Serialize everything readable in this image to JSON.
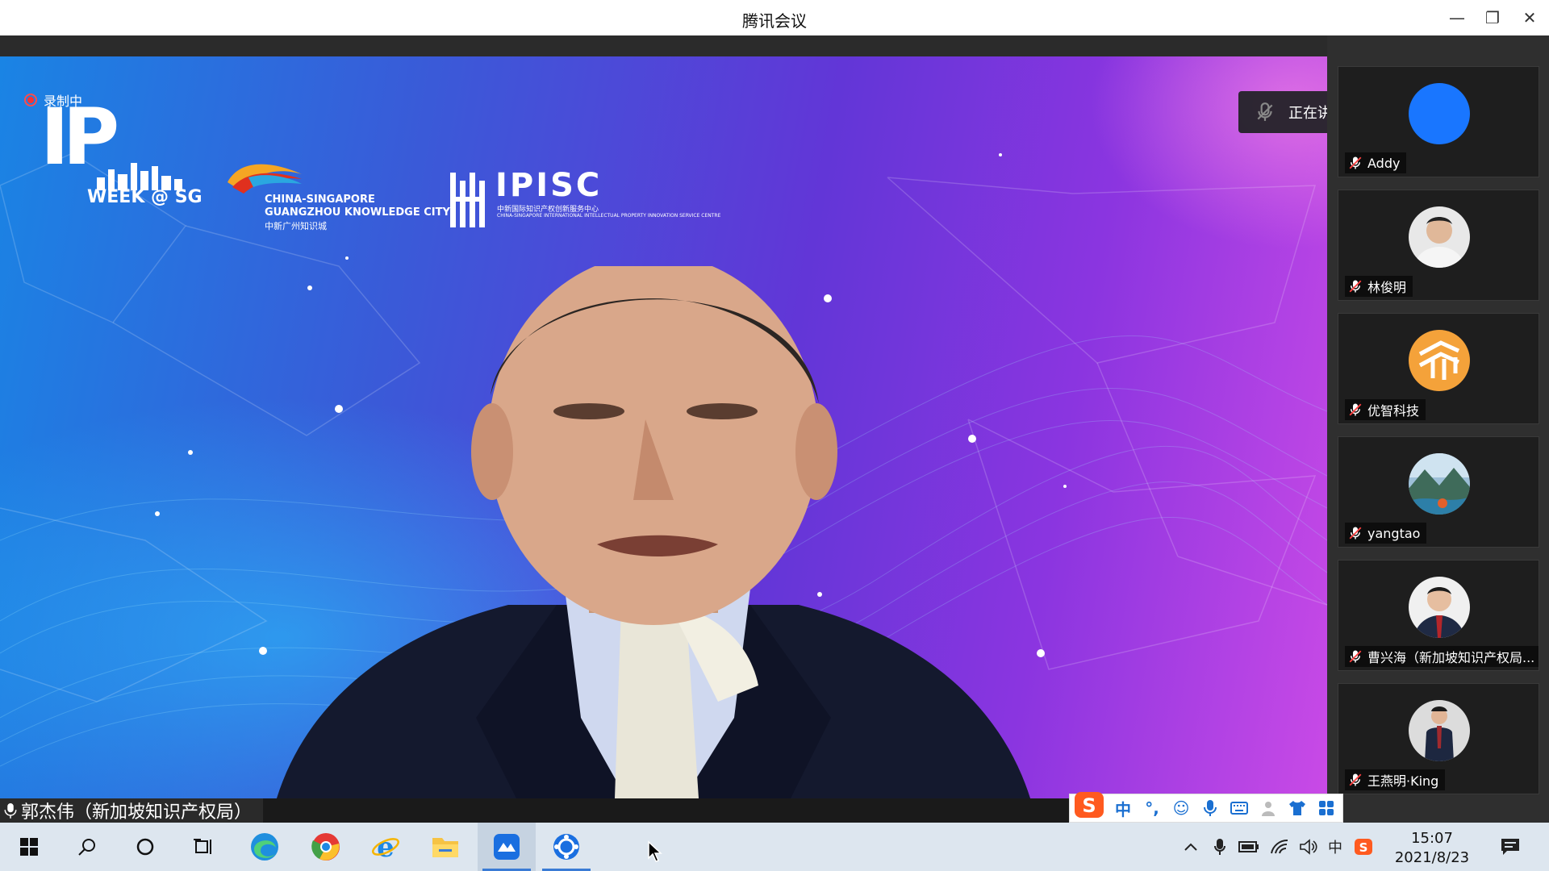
{
  "window": {
    "title": "腾讯会议"
  },
  "meeting": {
    "recording_label": "录制中",
    "speaking_text": "正在讲话: 郭杰伟（新加坡知识...",
    "main_speaker_name": "郭杰伟（新加坡知识产权局）",
    "logos": {
      "ip_big": "IP",
      "ip_week": "WEEK @ SG",
      "cs_line1": "CHINA-SINGAPORE",
      "cs_line2": "GUANGZHOU KNOWLEDGE CITY",
      "cs_line3": "中新广州知识城",
      "ipisc_name": "IPISC",
      "ipisc_cn": "中新国际知识产权创新服务中心",
      "ipisc_en": "CHINA-SINGAPORE INTERNATIONAL INTELLECTUAL PROPERTY INNOVATION SERVICE CENTRE"
    }
  },
  "participants": [
    {
      "name": "Addy",
      "avatar": "blue-circle-avatar"
    },
    {
      "name": "林俊明",
      "avatar": "man-photo-avatar"
    },
    {
      "name": "优智科技",
      "avatar": "orange-logo-avatar"
    },
    {
      "name": "yangtao",
      "avatar": "landscape-avatar"
    },
    {
      "name": "曹兴海（新加坡知识产权局...",
      "avatar": "man-suit-avatar"
    },
    {
      "name": "王燕明·King",
      "avatar": "man-standing-avatar"
    }
  ],
  "ime": {
    "items": [
      "中",
      "°,",
      "☺",
      "mic",
      "keyboard",
      "user",
      "shirt",
      "grid"
    ]
  },
  "taskbar": {
    "apps": [
      "start",
      "search",
      "cortana",
      "task-view",
      "edge",
      "chrome",
      "ie",
      "file-explorer",
      "tencent-meeting",
      "app-6"
    ],
    "tray_lang": "中",
    "time": "15:07",
    "date": "2021/8/23"
  },
  "colors": {
    "accent": "#3a7bd5",
    "video_left": "#1a84e4",
    "video_right": "#c94ae6",
    "rec_red": "#ff3030"
  }
}
